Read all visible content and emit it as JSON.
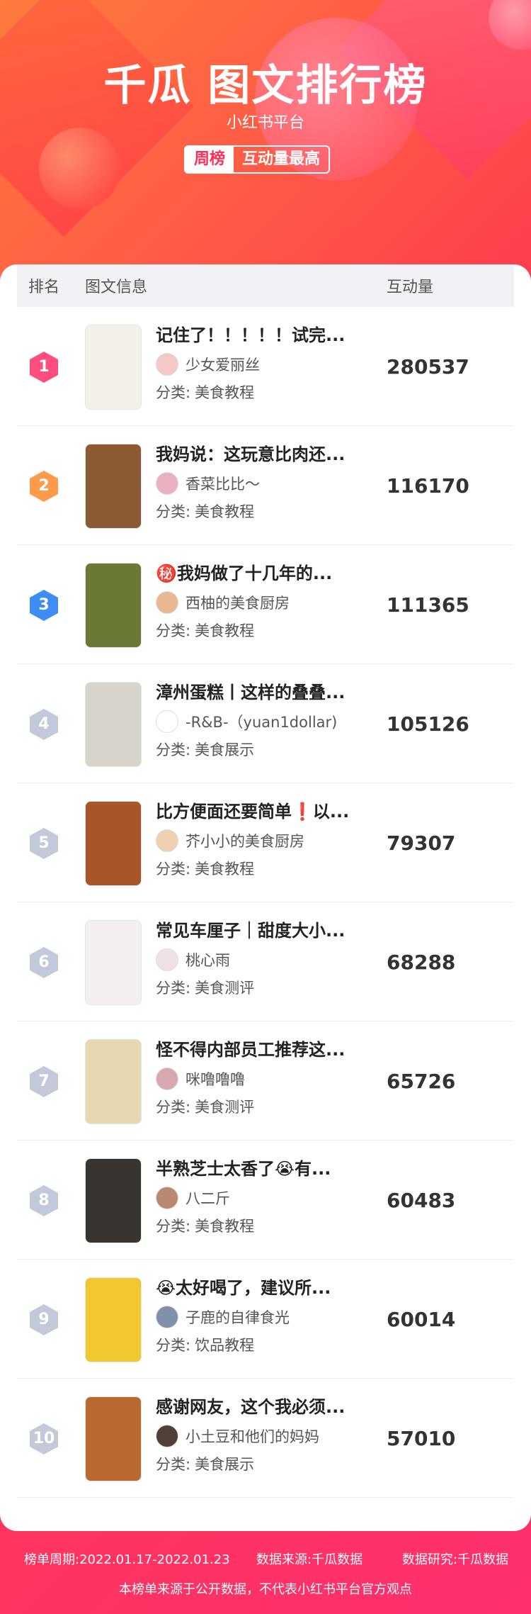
{
  "header": {
    "title": "千瓜 图文排行榜",
    "subtitle": "小红书平台",
    "tab_week": "周榜",
    "tab_metric": "互动量最高"
  },
  "table": {
    "col_rank": "排名",
    "col_info": "图文信息",
    "col_count": "互动量"
  },
  "category_label": "分类:",
  "rows": [
    {
      "rank": "1",
      "title": "记住了！！！！！试完...",
      "author": "少女爱丽丝",
      "category": "美食教程",
      "count": "280537",
      "badge_color": "#ff4d7d",
      "thumb_color": "#f3f0ea",
      "avatar_color": "#f5c8c8"
    },
    {
      "rank": "2",
      "title": "我妈说：这玩意比肉还...",
      "author": "香菜比比～",
      "category": "美食教程",
      "count": "116170",
      "badge_color": "#ff9a4a",
      "thumb_color": "#8a5a35",
      "avatar_color": "#e9b0c0"
    },
    {
      "rank": "3",
      "title": "㊙️我妈做了十几年的...",
      "author": "西柚的美食厨房",
      "category": "美食教程",
      "count": "111365",
      "badge_color": "#3d8df5",
      "thumb_color": "#6a7a35",
      "avatar_color": "#e8b890"
    },
    {
      "rank": "4",
      "title": "漳州蛋糕丨这样的叠叠...",
      "author": "-R&B-（yuan1dollar)",
      "category": "美食展示",
      "count": "105126",
      "badge_color": "#c4c9d9",
      "thumb_color": "#d8d4cc",
      "avatar_color": "#ffffff"
    },
    {
      "rank": "5",
      "title": "比方便面还要简单❗以...",
      "author": "芥小小的美食厨房",
      "category": "美食教程",
      "count": "79307",
      "badge_color": "#c4c9d9",
      "thumb_color": "#a8552a",
      "avatar_color": "#f0d0b0"
    },
    {
      "rank": "6",
      "title": "常见车厘子｜甜度大小...",
      "author": "桃心雨",
      "category": "美食测评",
      "count": "68288",
      "badge_color": "#c4c9d9",
      "thumb_color": "#f4eeee",
      "avatar_color": "#f0e0e8"
    },
    {
      "rank": "7",
      "title": "怪不得内部员工推荐这...",
      "author": "咪噜噜噜",
      "category": "美食测评",
      "count": "65726",
      "badge_color": "#c4c9d9",
      "thumb_color": "#e8d8b0",
      "avatar_color": "#d8a8b0"
    },
    {
      "rank": "8",
      "title": "半熟芝士太香了😭有...",
      "author": "八二斤",
      "category": "美食教程",
      "count": "60483",
      "badge_color": "#c4c9d9",
      "thumb_color": "#3a3430",
      "avatar_color": "#b88870"
    },
    {
      "rank": "9",
      "title": "😭太好喝了，建议所...",
      "author": "子鹿的自律食光",
      "category": "饮品教程",
      "count": "60014",
      "badge_color": "#c4c9d9",
      "thumb_color": "#f2c830",
      "avatar_color": "#8090a8"
    },
    {
      "rank": "10",
      "title": "感谢网友，这个我必须...",
      "author": "小土豆和他们的妈妈",
      "category": "美食展示",
      "count": "57010",
      "badge_color": "#c4c9d9",
      "thumb_color": "#b86a30",
      "avatar_color": "#504038"
    }
  ],
  "footer": {
    "period": "榜单周期:2022.01.17-2022.01.23",
    "source": "数据来源:千瓜数据",
    "research": "数据研究:千瓜数据",
    "disclaimer": "本榜单来源于公开数据，不代表小红书平台官方观点"
  }
}
